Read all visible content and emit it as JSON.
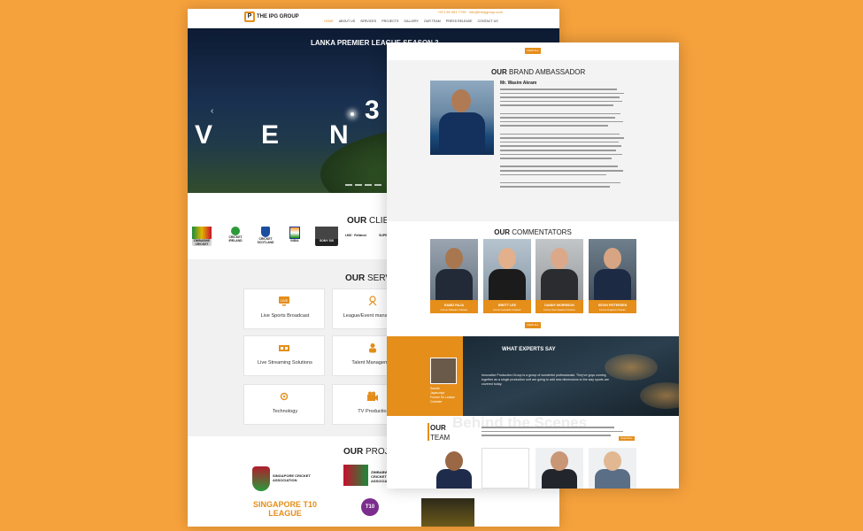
{
  "colors": {
    "background": "#f5a13c",
    "accent": "#e58e1a"
  },
  "back_page": {
    "brand": {
      "logo_text": "THE IPG GROUP"
    },
    "topbar": {
      "phone": "+971 55 951 7795",
      "email": "info@theipgroup.com"
    },
    "nav": [
      "HOME",
      "ABOUT US",
      "SERVICES",
      "PROJECTS",
      "GALLERY",
      "OUR TEAM",
      "PRESS RELEASE",
      "CONTACT US"
    ],
    "hero": {
      "title": "LANKA PREMIER LEAGUE SEASON 3",
      "slide_letters": [
        "V",
        "E",
        "N",
        "3"
      ],
      "prev_icon": "chevron-left-icon",
      "next_icon": "chevron-right-icon"
    },
    "clients": {
      "title_bold": "OUR",
      "title_light": " CLIENTS",
      "logos": [
        "ZIMBABWE CRICKET",
        "CRICKET IRELAND",
        "CRICKET SCOTLAND",
        "INDIA",
        "SONY SIX",
        "LMG · Reliance",
        "SUPER"
      ]
    },
    "services": {
      "title_bold": "OUR",
      "title_light": " SERVICES",
      "items": [
        {
          "label": "Live Sports Broadcast",
          "icon": "live-tv-icon"
        },
        {
          "label": "League/Event management",
          "icon": "event-icon"
        },
        {
          "label": "Live Streaming Solutions",
          "icon": "streaming-icon"
        },
        {
          "label": "Talent Management",
          "icon": "talent-icon"
        },
        {
          "label": "Technology",
          "icon": "technology-icon"
        },
        {
          "label": "TV Production",
          "icon": "tv-production-icon"
        }
      ]
    },
    "projects": {
      "title_bold": "OUR",
      "title_light": " PROJECTS",
      "items": [
        "SINGAPORE CRICKET ASSOCIATION",
        "SINGAPORE T10 LEAGUE",
        "ZIMBABWE CRICKET ASSOCIATION",
        "T10"
      ]
    }
  },
  "front_page": {
    "tag": "VIEW ALL",
    "ambassador": {
      "title_bold": "OUR",
      "title_light": " BRAND AMBASSADOR",
      "name": "Mr. Wasim Akram"
    },
    "commentators": {
      "title_bold": "OUR",
      "title_light": " COMMENTATORS",
      "items": [
        {
          "name": "RAMIZ RAJA",
          "role": "Former Pakistani Cricketer"
        },
        {
          "name": "BRETT LEE",
          "role": "Former Australian Cricketer"
        },
        {
          "name": "DANNY MORRISON",
          "role": "Former New Zealand Cricketer"
        },
        {
          "name": "KEVIN PIETERSEN",
          "role": "Former England Cricketer"
        }
      ]
    },
    "experts": {
      "title": "WHAT EXPERTS SAY",
      "quote": "Innovative Production Group is a group of wonderful professionals. They've guys coming together as a single production unit are going to add new dimensions to the way sports are covered today.",
      "person": [
        "Sanath",
        "Jayasuriya",
        "Former Sri Lankan",
        "Cricketer"
      ]
    },
    "team": {
      "title_bold": "OUR",
      "title_light": "TEAM",
      "ghost": "Behind the Scenes",
      "read_more": "Read More"
    }
  }
}
